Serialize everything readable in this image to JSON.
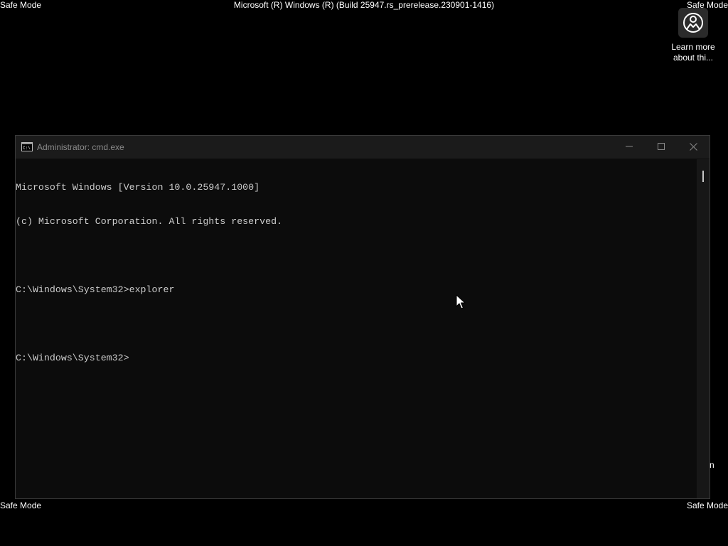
{
  "desktop": {
    "safe_mode_top_left": "Safe Mode",
    "safe_mode_top_right": "Safe Mode",
    "safe_mode_bottom_left": "Safe Mode",
    "safe_mode_bottom_right": "Safe Mode",
    "build_text": "Microsoft (R) Windows (R) (Build 25947.rs_prerelease.230901-1416)",
    "learn_more_icon": {
      "icon": "learn-more-icon",
      "caption_line1": "Learn more",
      "caption_line2": "about thi..."
    },
    "partial_text": "n"
  },
  "window": {
    "title": "Administrator: cmd.exe",
    "app_icon": "cmd-icon",
    "controls": {
      "minimize_icon": "minimize-icon",
      "maximize_icon": "maximize-icon",
      "close_icon": "close-icon"
    },
    "console_lines": [
      "Microsoft Windows [Version 10.0.25947.1000]",
      "(c) Microsoft Corporation. All rights reserved.",
      "",
      "C:\\Windows\\System32>explorer",
      "",
      "C:\\Windows\\System32>"
    ]
  },
  "colors": {
    "desktop_bg": "#000000",
    "console_bg": "#0c0c0c",
    "console_text": "#cccccc",
    "titlebar_bg": "#1b1b1b",
    "title_text": "#8a8a8a"
  }
}
